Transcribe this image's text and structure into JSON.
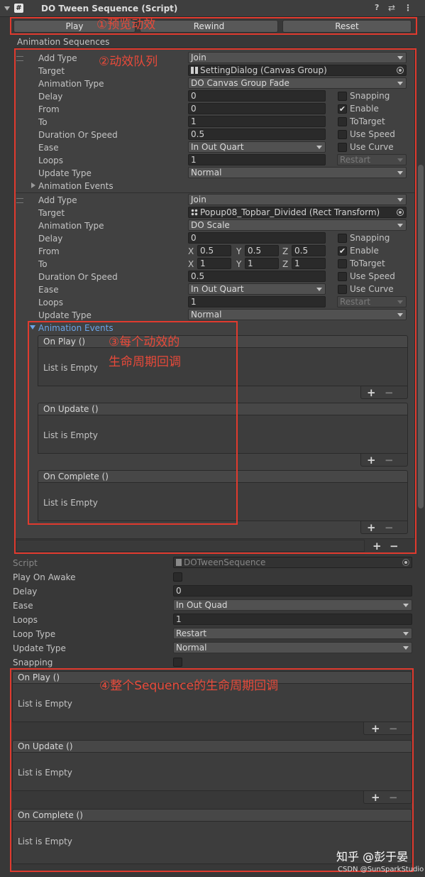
{
  "header": {
    "title": "DO Tween Sequence (Script)",
    "help_icon": "?",
    "settings_icon": "⇄",
    "more_icon": "⋮"
  },
  "preview": {
    "play": "Play",
    "rewind": "Rewind",
    "reset": "Reset"
  },
  "section_title": "Animation Sequences",
  "labels": {
    "add_type": "Add Type",
    "target": "Target",
    "animation_type": "Animation Type",
    "delay": "Delay",
    "from": "From",
    "to": "To",
    "duration": "Duration Or Speed",
    "ease": "Ease",
    "loops": "Loops",
    "update_type": "Update Type",
    "animation_events": "Animation Events",
    "snapping": "Snapping",
    "enable": "Enable",
    "to_target": "ToTarget",
    "use_speed": "Use Speed",
    "use_curve": "Use Curve"
  },
  "seq1": {
    "add_type": "Join",
    "target": "SettingDialog (Canvas Group)",
    "animation_type": "DO Canvas Group Fade",
    "delay": "0",
    "from": "0",
    "to": "1",
    "duration": "0.5",
    "ease": "In Out Quart",
    "loops": "1",
    "loop_type": "Restart",
    "update_type": "Normal",
    "enable_checked": "✔"
  },
  "seq2": {
    "add_type": "Join",
    "target": "Popup08_Topbar_Divided (Rect Transform)",
    "animation_type": "DO Scale",
    "delay": "0",
    "from": {
      "x": "0.5",
      "y": "0.5",
      "z": "0.5"
    },
    "to": {
      "x": "1",
      "y": "1",
      "z": "1"
    },
    "duration": "0.5",
    "ease": "In Out Quart",
    "loops": "1",
    "loop_type": "Restart",
    "update_type": "Normal",
    "enable_checked": "✔"
  },
  "xyz": {
    "x": "X",
    "y": "Y",
    "z": "Z"
  },
  "events": {
    "on_play": "On Play ()",
    "on_update": "On Update ()",
    "on_complete": "On Complete ()",
    "empty": "List is Empty",
    "plus": "+",
    "minus": "−"
  },
  "component": {
    "script_label": "Script",
    "script_value": "DOTweenSequence",
    "play_on_awake": "Play On Awake",
    "delay": "Delay",
    "delay_value": "0",
    "ease": "Ease",
    "ease_value": "In Out Quad",
    "loops": "Loops",
    "loops_value": "1",
    "loop_type": "Loop Type",
    "loop_type_value": "Restart",
    "update_type": "Update Type",
    "update_type_value": "Normal",
    "snapping": "Snapping"
  },
  "annotations": {
    "a1": "①预览动效",
    "a2": "②动效队列",
    "a3_line1": "③每个动效的",
    "a3_line2": "生命周期回调",
    "a4": "④整个Sequence的生命周期回调"
  },
  "watermark": {
    "zhihu": "知乎 @彭于晏",
    "csdn": "CSDN @SunSparkStudio"
  },
  "colors": {
    "annotation": "#e03a2e",
    "panel": "#383838",
    "field": "#2a2a2a",
    "dropdown": "#515151",
    "link": "#6aa5e8"
  }
}
